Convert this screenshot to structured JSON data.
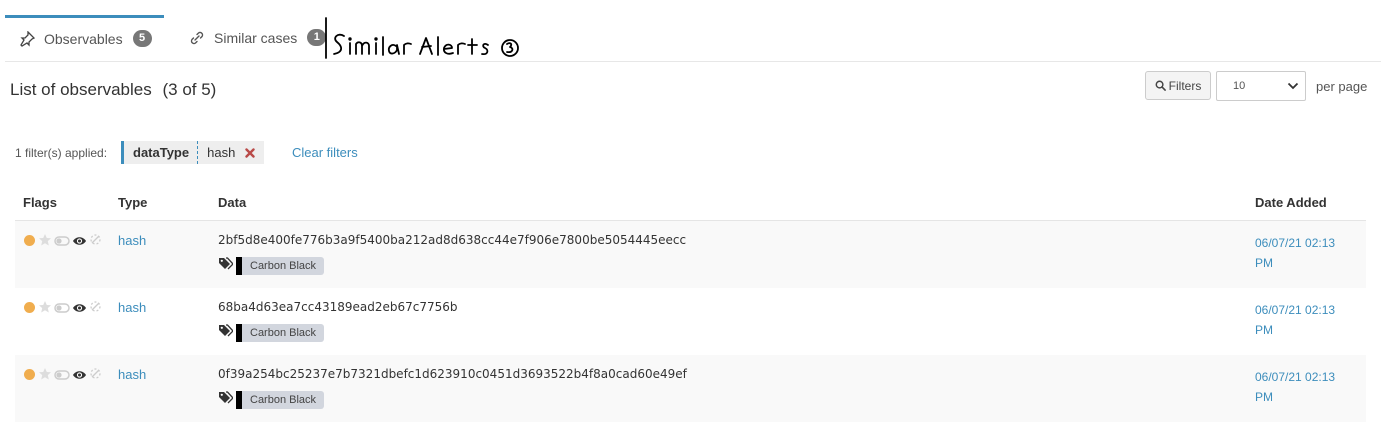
{
  "tabs": [
    {
      "label": "Observables",
      "count": "5",
      "icon": "pin-icon"
    },
    {
      "label": "Similar cases",
      "count": "1",
      "icon": "link-icon"
    }
  ],
  "annotation": {
    "text": "Similar Alerts",
    "count": "3"
  },
  "list": {
    "title": "List of observables",
    "count_text": "(3 of 5)",
    "filters_button": "Filters",
    "page_size": "10",
    "per_page_label": "per page"
  },
  "filter_bar": {
    "applied_label": "1 filter(s) applied:",
    "filter_key": "dataType",
    "filter_value": "hash",
    "clear_label": "Clear filters"
  },
  "table": {
    "headers": {
      "flags": "Flags",
      "type": "Type",
      "data": "Data",
      "date": "Date Added"
    },
    "rows": [
      {
        "type": "hash",
        "data": "2bf5d8e400fe776b3a9f5400ba212ad8d638cc44e7f906e7800be5054445eecc",
        "tag": "Carbon Black",
        "date_line1": "06/07/21 02:13",
        "date_line2": "PM"
      },
      {
        "type": "hash",
        "data": "68ba4d63ea7cc43189ead2eb67c7756b",
        "tag": "Carbon Black",
        "date_line1": "06/07/21 02:13",
        "date_line2": "PM"
      },
      {
        "type": "hash",
        "data": "0f39a254bc25237e7b7321dbefc1d623910c0451d3693522b4f8a0cad60e49ef",
        "tag": "Carbon Black",
        "date_line1": "06/07/21 02:13",
        "date_line2": "PM"
      }
    ]
  },
  "colors": {
    "accent": "#3c8dbc",
    "flag_orange": "#f0ad4e",
    "remove_red": "#b94a48",
    "tag_bg": "#d2d6de"
  }
}
